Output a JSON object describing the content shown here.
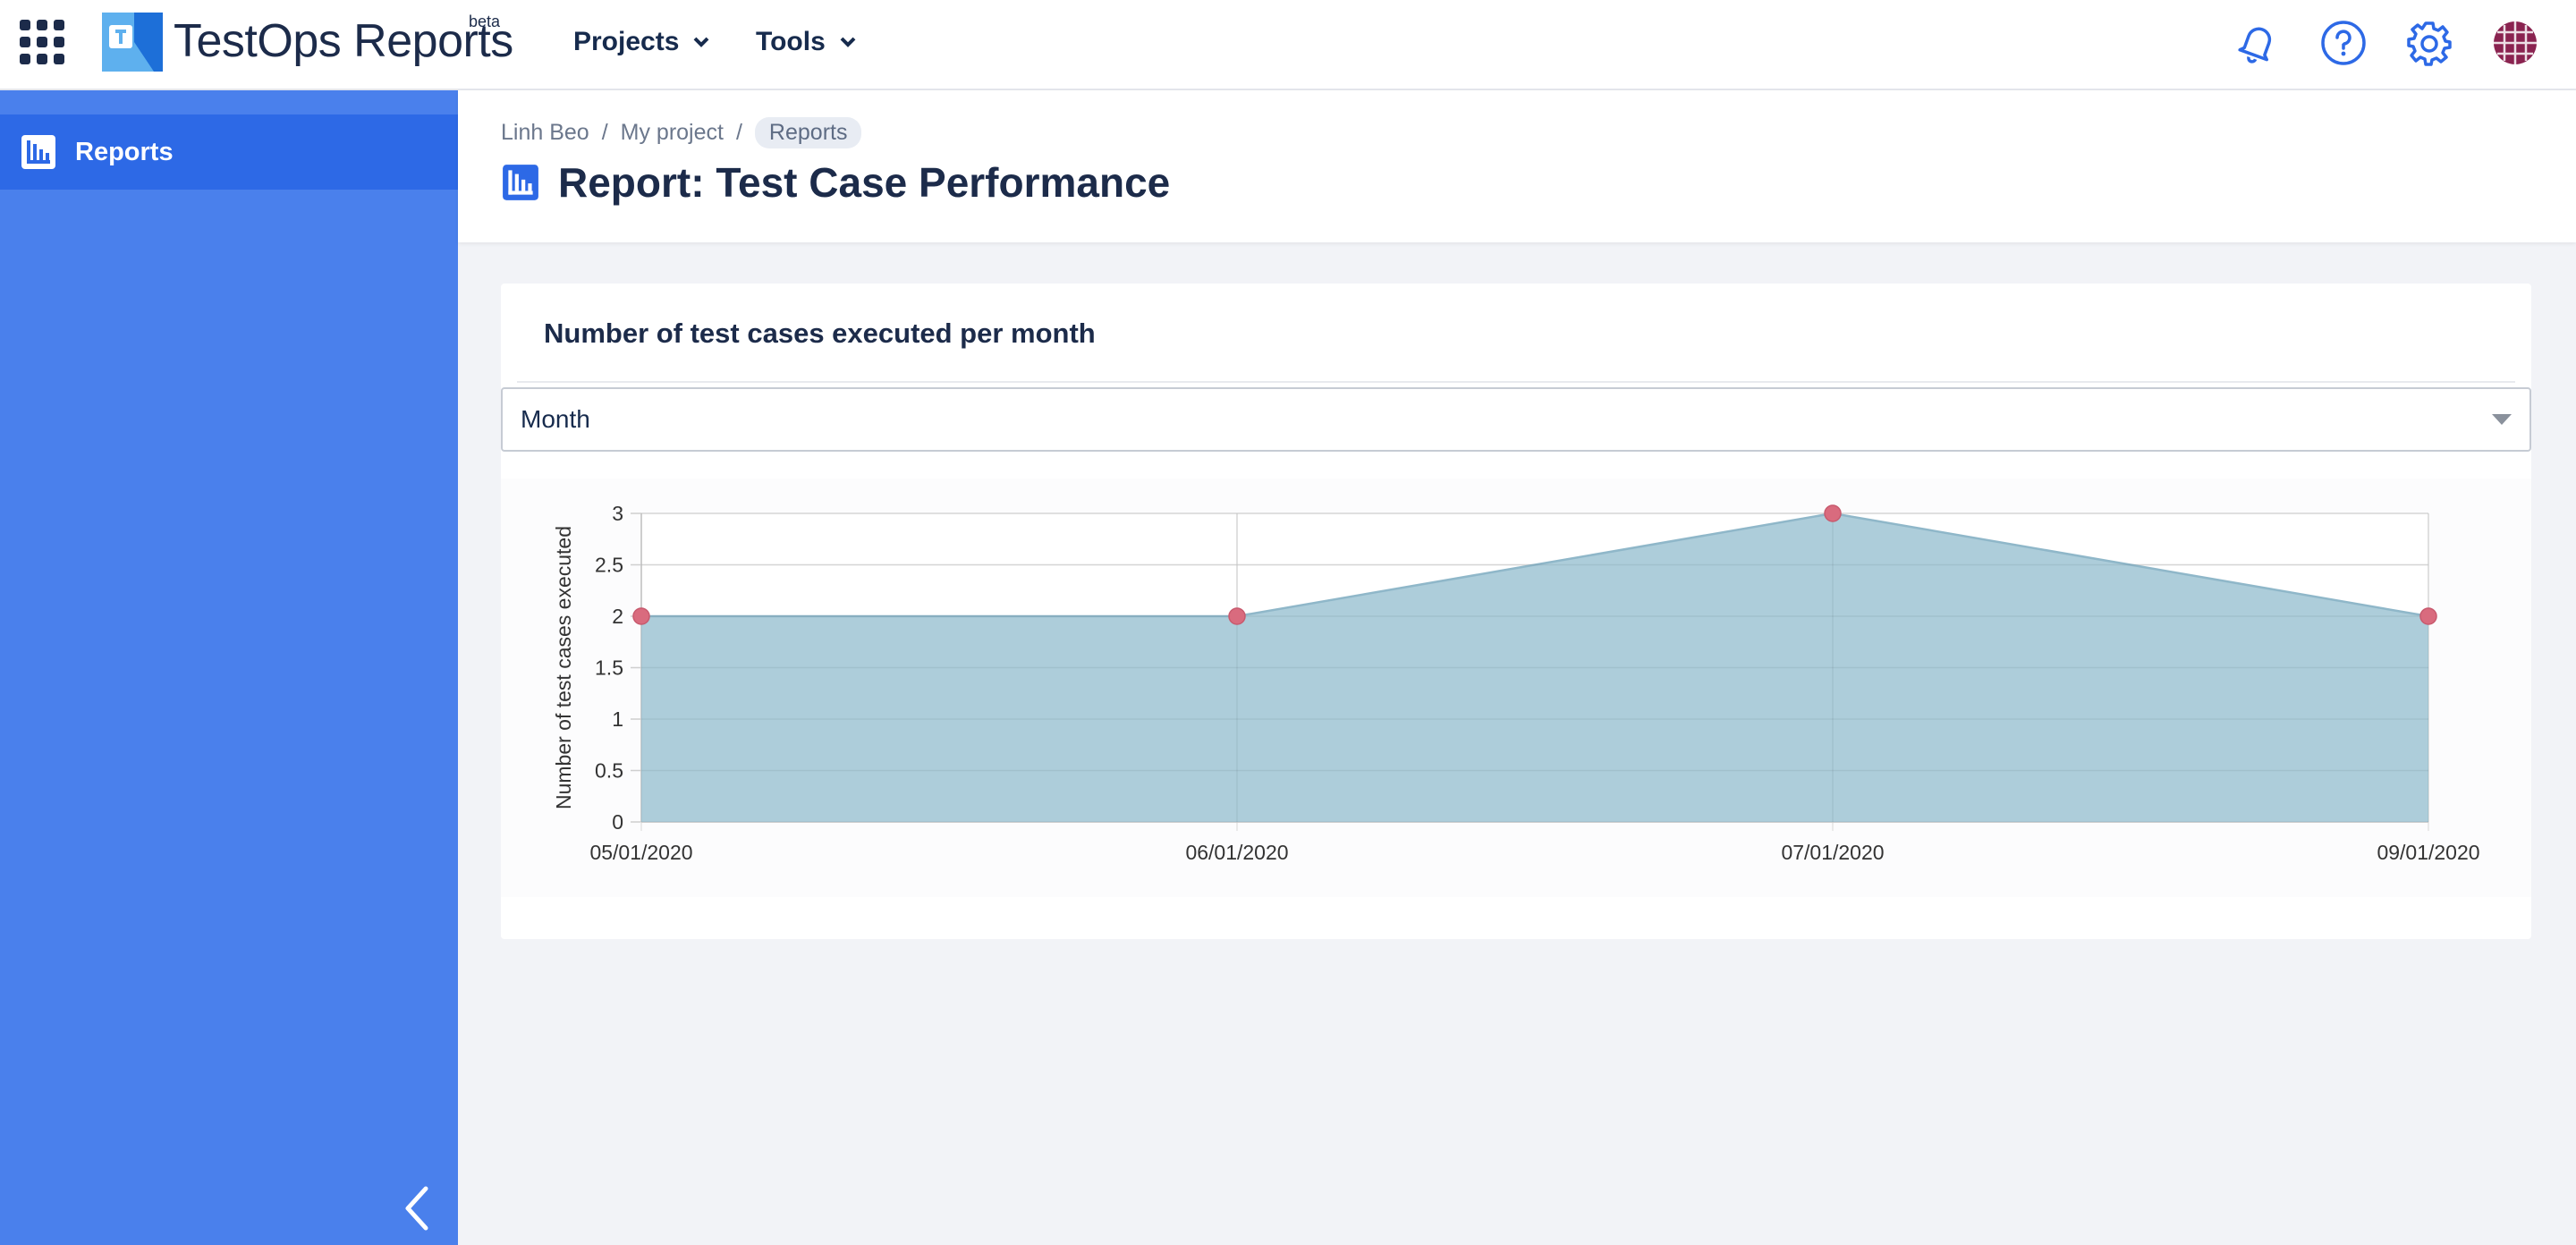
{
  "header": {
    "brand": "TestOps Reports",
    "beta": "beta",
    "nav": [
      {
        "label": "Projects"
      },
      {
        "label": "Tools"
      }
    ]
  },
  "sidebar": {
    "items": [
      {
        "label": "Reports",
        "icon": "report-chart-icon",
        "active": true
      }
    ]
  },
  "breadcrumb": {
    "items": [
      "Linh Beo",
      "My project",
      "Reports"
    ],
    "separator": "/"
  },
  "page": {
    "title": "Report: Test Case Performance"
  },
  "card": {
    "title": "Number of test cases executed per month",
    "select_value": "Month"
  },
  "colors": {
    "accent": "#2d69e6",
    "sidebar": "#4a80ec",
    "area_fill": "#a9cad8",
    "area_line": "#8fb7c9",
    "point": "#d96b7e"
  },
  "chart_data": {
    "type": "area",
    "x": [
      "05/01/2020",
      "06/01/2020",
      "07/01/2020",
      "09/01/2020"
    ],
    "series": [
      {
        "values": [
          2,
          2,
          3,
          2
        ]
      }
    ],
    "ylabel": "Number of test cases executed",
    "xlabel": "",
    "ylim": [
      0,
      3
    ],
    "yticks": [
      "0",
      "0.5",
      "1",
      "1.5",
      "2",
      "2.5",
      "3"
    ],
    "grid": true
  }
}
